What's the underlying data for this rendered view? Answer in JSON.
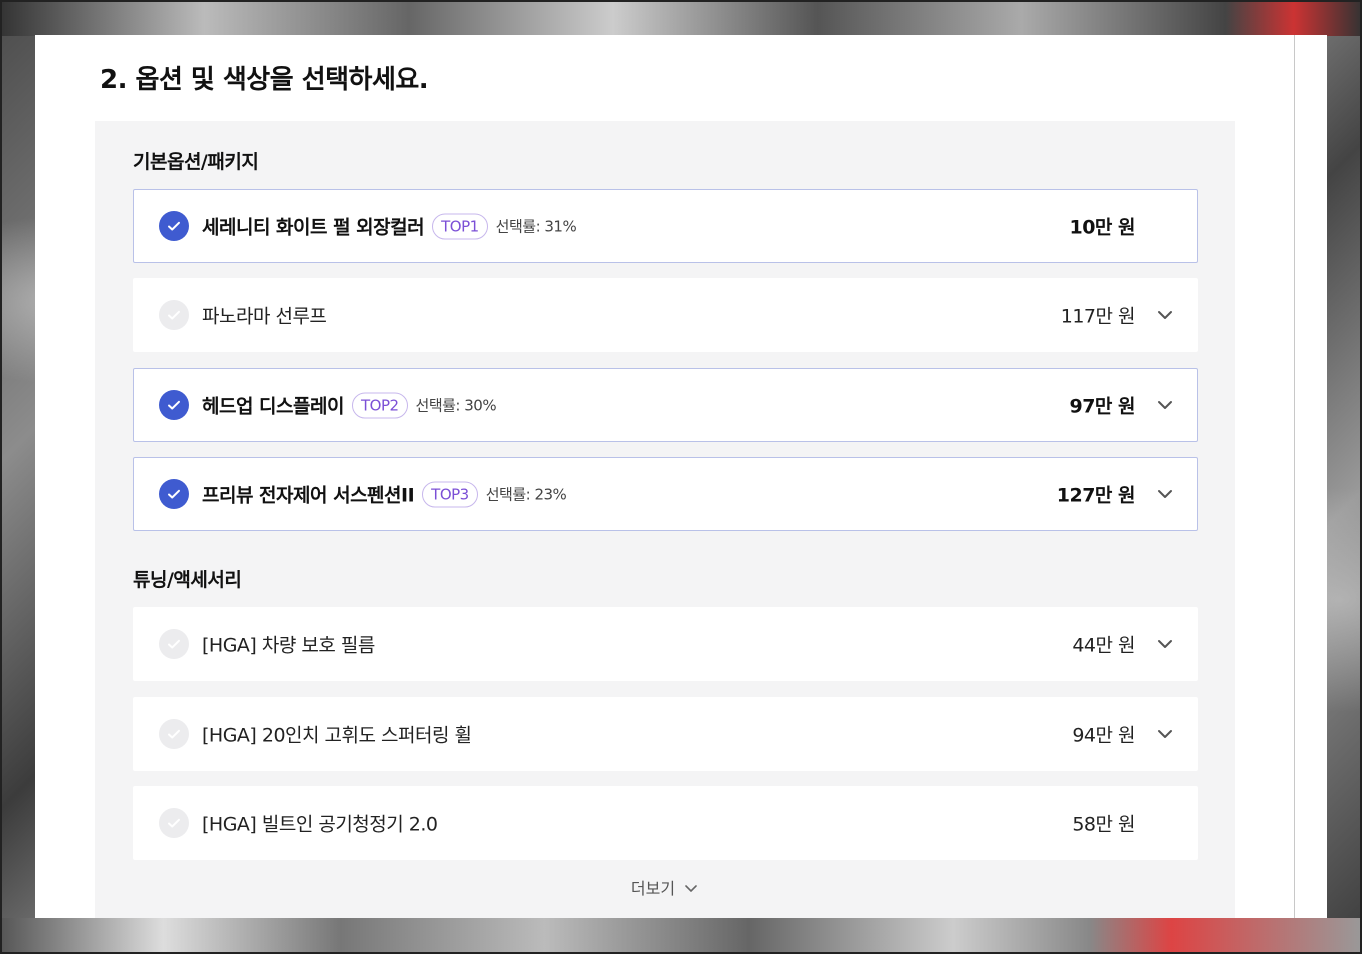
{
  "page": {
    "title": "2. 옵션 및 색상을 선택하세요."
  },
  "sections": [
    {
      "title": "기본옵션/패키지",
      "items": [
        {
          "name": "세레니티 화이트 펄 외장컬러",
          "badge": "TOP1",
          "rate": "선택률: 31%",
          "price": "10만 원",
          "selected": true,
          "expandable": false
        },
        {
          "name": "파노라마 선루프",
          "badge": "",
          "rate": "",
          "price": "117만 원",
          "selected": false,
          "expandable": true
        },
        {
          "name": "헤드업 디스플레이",
          "badge": "TOP2",
          "rate": "선택률: 30%",
          "price": "97만 원",
          "selected": true,
          "expandable": true
        },
        {
          "name": "프리뷰 전자제어 서스펜션II",
          "badge": "TOP3",
          "rate": "선택률: 23%",
          "price": "127만 원",
          "selected": true,
          "expandable": true
        }
      ]
    },
    {
      "title": "튜닝/액세서리",
      "items": [
        {
          "name": "[HGA] 차량 보호 필름",
          "badge": "",
          "rate": "",
          "price": "44만 원",
          "selected": false,
          "expandable": true
        },
        {
          "name": "[HGA] 20인치 고휘도 스퍼터링 휠",
          "badge": "",
          "rate": "",
          "price": "94만 원",
          "selected": false,
          "expandable": true
        },
        {
          "name": "[HGA] 빌트인 공기청정기 2.0",
          "badge": "",
          "rate": "",
          "price": "58만 원",
          "selected": false,
          "expandable": false
        }
      ]
    }
  ],
  "more_label": "더보기",
  "colors": {
    "accent": "#3f5bd0",
    "badge": "#7b4fd6",
    "selected_border": "#b9c1e8",
    "box_bg": "#f4f4f5"
  },
  "icons": {
    "check": "check-icon",
    "expand": "chevron-down-icon"
  }
}
